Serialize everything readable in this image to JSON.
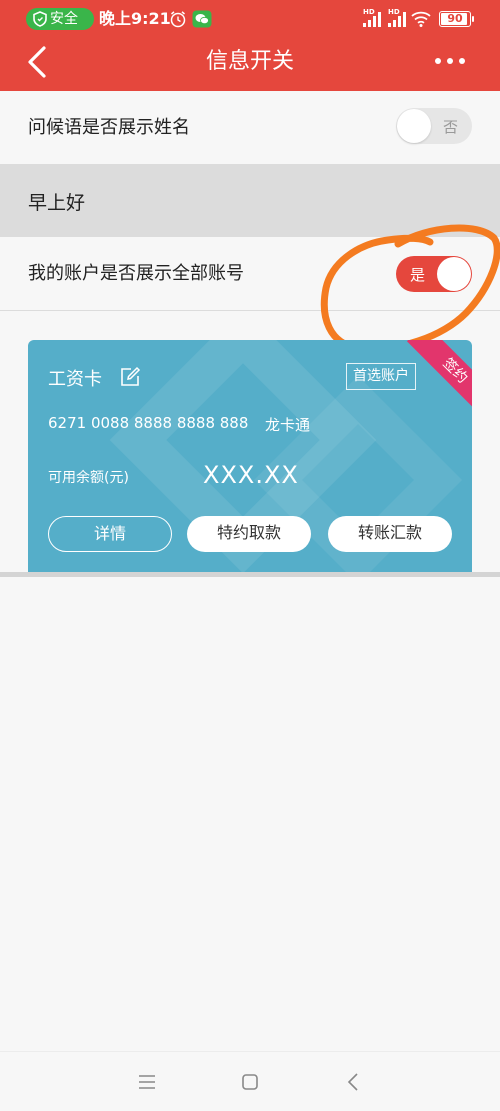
{
  "status_bar": {
    "safe_label": "安全",
    "time": "晚上9:21",
    "hd1": "HD",
    "hd2": "HD",
    "battery": "90"
  },
  "header": {
    "title": "信息开关"
  },
  "settings": {
    "greeting_name_label": "问候语是否展示姓名",
    "greeting_name_toggle": "否",
    "greeting_name_on": false,
    "greeting_text": "早上好",
    "all_accounts_label": "我的账户是否展示全部账号",
    "all_accounts_toggle": "是",
    "all_accounts_on": true
  },
  "card": {
    "name": "工资卡",
    "preferred_badge": "首选账户",
    "ribbon": "签约",
    "account_number": "6271 0088 8888 8888 888",
    "account_type": "龙卡通",
    "balance_label": "可用余额(元)",
    "balance_value": "XXX.XX",
    "buttons": {
      "details": "详情",
      "special_withdraw": "特约取款",
      "transfer": "转账汇款"
    }
  },
  "colors": {
    "header_red": "#e5473d",
    "card_blue": "#55aec9",
    "ribbon_pink": "#e2356c",
    "safe_green": "#3ab54a",
    "annotation_orange": "#f47b20"
  },
  "icons": {
    "back": "back-chevron-icon",
    "more": "more-dots-icon",
    "edit": "edit-icon",
    "nav_menu": "menu-icon",
    "nav_home": "home-icon",
    "nav_back": "nav-back-icon"
  }
}
